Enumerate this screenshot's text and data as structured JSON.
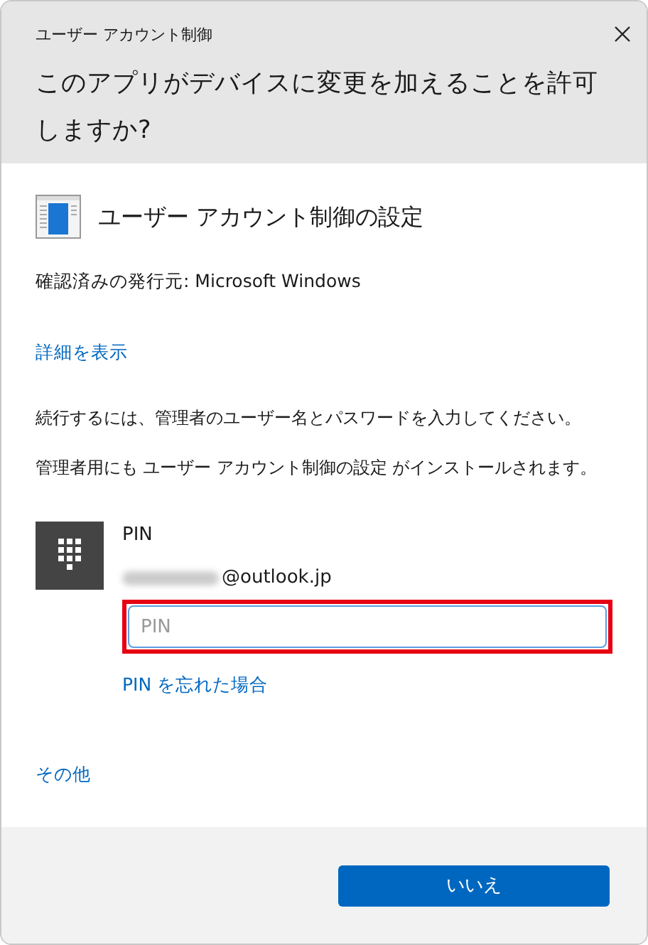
{
  "window": {
    "title": "ユーザー アカウント制御"
  },
  "question": "このアプリがデバイスに変更を加えることを許可しますか?",
  "app": {
    "name": "ユーザー アカウント制御の設定"
  },
  "publisher": "確認済みの発行元: Microsoft Windows",
  "details_link": "詳細を表示",
  "instructions": [
    "続行するには、管理者のユーザー名とパスワードを入力してください。",
    "管理者用にも ユーザー アカウント制御の設定 がインストールされます。"
  ],
  "credential": {
    "label": "PIN",
    "account": "@outlook.jp",
    "account_redacted": true,
    "pin_field": {
      "placeholder": "PIN",
      "highlighted": true
    },
    "forgot_link": "PIN を忘れた場合"
  },
  "more_link": "その他",
  "buttons": [
    "いいえ"
  ]
}
